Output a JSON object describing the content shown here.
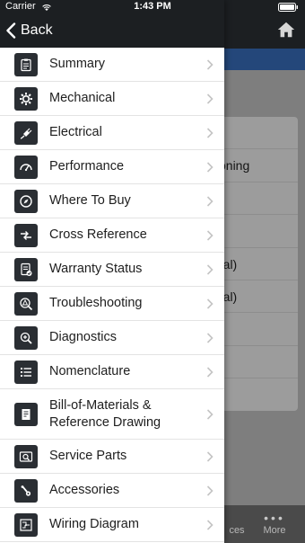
{
  "status_bar": {
    "carrier": "Carrier",
    "time": "1:43 PM"
  },
  "header": {
    "back_label": "Back"
  },
  "menu": [
    {
      "label": "Summary",
      "icon": "clipboard-icon"
    },
    {
      "label": "Mechanical",
      "icon": "gear-icon"
    },
    {
      "label": "Electrical",
      "icon": "plug-icon"
    },
    {
      "label": "Performance",
      "icon": "speedometer-icon"
    },
    {
      "label": "Where To Buy",
      "icon": "compass-icon"
    },
    {
      "label": "Cross Reference",
      "icon": "swap-arrows-icon"
    },
    {
      "label": "Warranty Status",
      "icon": "document-check-icon"
    },
    {
      "label": "Troubleshooting",
      "icon": "magnifier-warning-icon"
    },
    {
      "label": "Diagnostics",
      "icon": "magnifier-plus-icon"
    },
    {
      "label": "Nomenclature",
      "icon": "list-icon"
    },
    {
      "label": "Bill-of-Materials & Reference Drawing",
      "icon": "drawing-icon"
    },
    {
      "label": "Service Parts",
      "icon": "parts-search-icon"
    },
    {
      "label": "Accessories",
      "icon": "tools-icon"
    },
    {
      "label": "Wiring Diagram",
      "icon": "circuit-icon"
    }
  ],
  "background": {
    "card_rows": [
      "",
      "oning",
      "",
      "",
      "ral)",
      "ral)",
      "",
      "",
      ""
    ],
    "tab_partial_label": "ces",
    "tab_more_label": "More"
  },
  "colors": {
    "header": "#1c1f22",
    "accent_blue": "#24477a",
    "icon_tile": "#2a2e33"
  }
}
